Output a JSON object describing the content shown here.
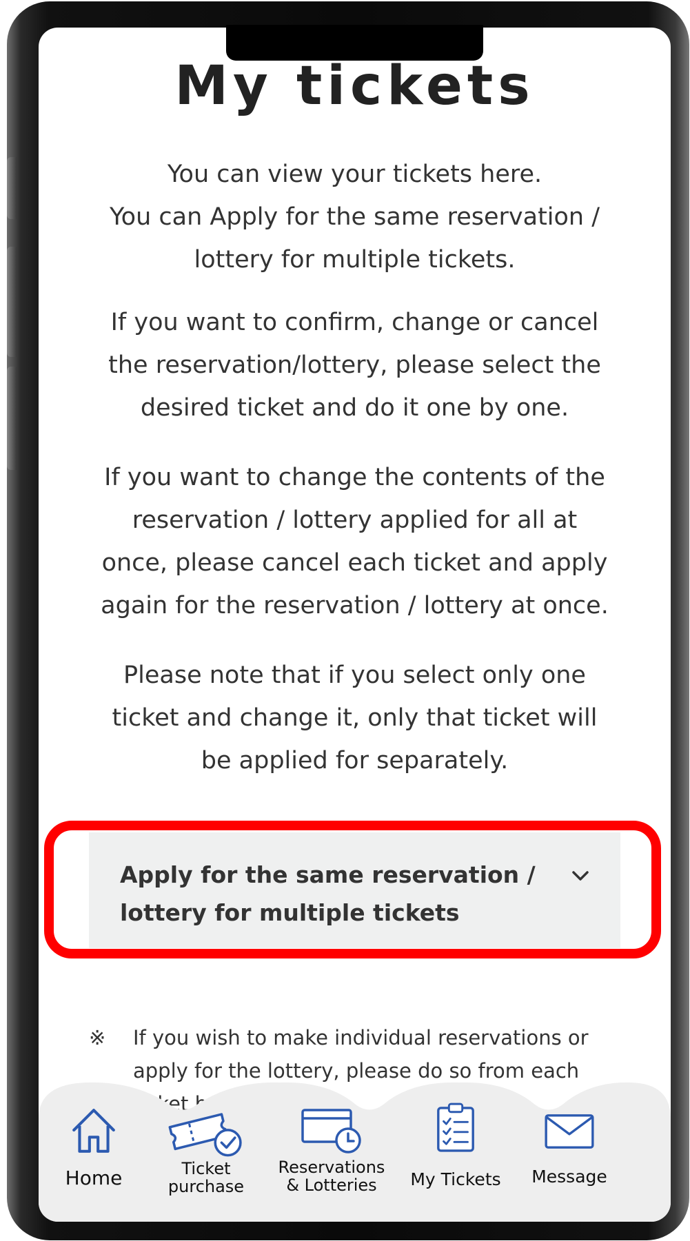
{
  "page": {
    "title": "My tickets",
    "paragraphs": [
      "You can view your tickets here.\nYou can Apply for the same reservation /\nlottery for multiple tickets.",
      "If you want to confirm, change or cancel\nthe reservation/lottery, please select the\ndesired ticket and do it one by one.",
      "If you want to change the contents of the\nreservation / lottery applied for all at\nonce, please cancel each ticket and apply\nagain for the reservation / lottery at once.",
      "Please note that if you select only one\nticket and change it, only that ticket will\nbe applied for separately."
    ]
  },
  "accordion": {
    "label": "Apply for the same reservation /\nlottery for multiple tickets",
    "icon": "chevron-down-icon",
    "highlight_color": "#ff0000"
  },
  "note": {
    "mark": "※",
    "text": "If you wish to make individual reservations or\napply for the lottery, please do so from each\nticket b"
  },
  "bottom_nav": {
    "accent_color": "#2c5ab0",
    "items": [
      {
        "label": "Home",
        "icon": "home-icon"
      },
      {
        "label": "Ticket\npurchase",
        "icon": "ticket-icon"
      },
      {
        "label": "Reservations\n& Lotteries",
        "icon": "calendar-clock-icon"
      },
      {
        "label": "My Tickets",
        "icon": "clipboard-checklist-icon"
      },
      {
        "label": "Message",
        "icon": "envelope-icon"
      }
    ]
  }
}
